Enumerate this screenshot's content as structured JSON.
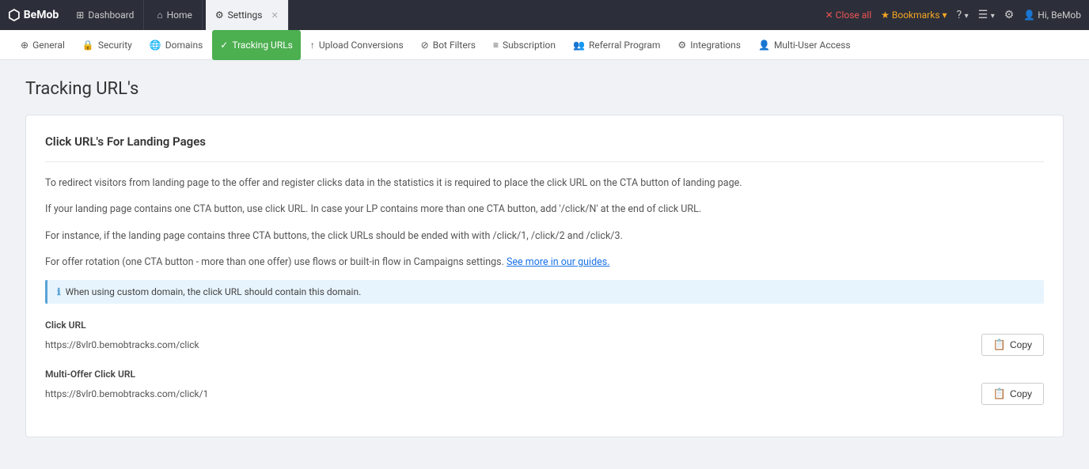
{
  "topBar": {
    "logo": "BeMob",
    "logo_icon": "⬡",
    "tabs": [
      {
        "id": "dashboard",
        "label": "Dashboard",
        "icon": "⊞",
        "active": false,
        "closable": false
      },
      {
        "id": "home",
        "label": "Home",
        "icon": "⌂",
        "active": false,
        "closable": false
      },
      {
        "id": "settings",
        "label": "Settings",
        "icon": "⚙",
        "active": true,
        "closable": true
      }
    ],
    "close_all": "Close all",
    "bookmarks": "Bookmarks",
    "help_icon": "?",
    "notifications_icon": "☰",
    "settings_icon": "⚙",
    "user": "Hi, BeMob"
  },
  "secondaryNav": {
    "items": [
      {
        "id": "general",
        "label": "General",
        "icon": "⊕",
        "active": false
      },
      {
        "id": "security",
        "label": "Security",
        "icon": "🔒",
        "active": false
      },
      {
        "id": "domains",
        "label": "Domains",
        "icon": "🌐",
        "active": false
      },
      {
        "id": "tracking-urls",
        "label": "Tracking URLs",
        "icon": "✓",
        "active": true
      },
      {
        "id": "upload-conversions",
        "label": "Upload Conversions",
        "icon": "↑",
        "active": false
      },
      {
        "id": "bot-filters",
        "label": "Bot Filters",
        "icon": "⊘",
        "active": false
      },
      {
        "id": "subscription",
        "label": "Subscription",
        "icon": "≡",
        "active": false
      },
      {
        "id": "referral-program",
        "label": "Referral Program",
        "icon": "👥",
        "active": false
      },
      {
        "id": "integrations",
        "label": "Integrations",
        "icon": "⚙",
        "active": false
      },
      {
        "id": "multi-user-access",
        "label": "Multi-User Access",
        "icon": "👤",
        "active": false
      }
    ]
  },
  "page": {
    "title": "Tracking URL's",
    "card": {
      "section_title": "Click URL's For Landing Pages",
      "description_line1": "To redirect visitors from landing page to the offer and register clicks data in the statistics it is required to place the click URL on the CTA button of landing page.",
      "description_line2": "If your landing page contains one CTA button, use click URL. In case your LP contains more than one CTA button, add '/click/N' at the end of click URL.",
      "description_line3": "For instance, if the landing page contains three CTA buttons, the click URLs should be ended with with /click/1, /click/2 and /click/3.",
      "rotation_text": "For offer rotation (one CTA button - more than one offer) use flows or built-in flow in Campaigns settings.",
      "see_more_link": "See more in our guides.",
      "info_text": "When using custom domain, the click URL should contain this domain.",
      "click_url": {
        "label": "Click URL",
        "value": "https://8vlr0.bemobtracks.com/click",
        "copy_label": "Copy"
      },
      "multi_offer_click_url": {
        "label": "Multi-Offer Click URL",
        "value": "https://8vlr0.bemobtracks.com/click/1",
        "copy_label": "Copy"
      }
    }
  }
}
